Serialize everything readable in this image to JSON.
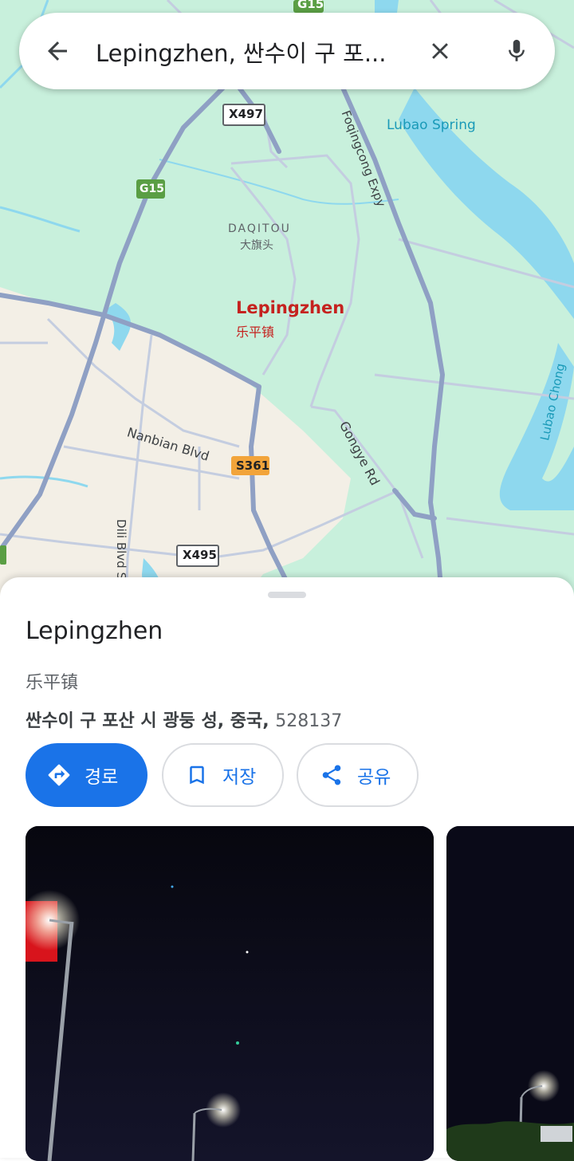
{
  "search": {
    "query": "Lepingzhen, 싼수이 구 포..."
  },
  "map": {
    "labels": {
      "g15_top": "G15",
      "x497": "X497",
      "foqingcong": "Foqingcong Expy",
      "lubao_spring": "Lubao Spring",
      "g15_mid": "G15",
      "daqitou": "DAQITOU",
      "daqitou_cn": "大旗头",
      "lepingzhen": "Lepingzhen",
      "lepingzhen_cn": "乐平镇",
      "lubao_chong": "Lubao Chong",
      "nanbian": "Nanbian Blvd",
      "gongye": "Gongye Rd",
      "s361": "S361",
      "dili": "Dili Blvd S",
      "x495": "X495"
    }
  },
  "place": {
    "name": "Lepingzhen",
    "local_name": "乐平镇",
    "address": "싼수이 구 포산 시 광둥 성, 중국, ",
    "postal_code": "528137"
  },
  "actions": {
    "directions": "경로",
    "save": "저장",
    "share": "공유"
  },
  "colors": {
    "accent": "#1a73e8",
    "map_green": "#c8f0dc",
    "water": "#8ed8ee",
    "road": "#8fa0c4",
    "place_red": "#c5221f"
  },
  "icons": {
    "back": "arrow-back-icon",
    "clear": "close-icon",
    "mic": "mic-icon",
    "directions": "directions-icon",
    "save": "bookmark-icon",
    "share": "share-icon"
  }
}
